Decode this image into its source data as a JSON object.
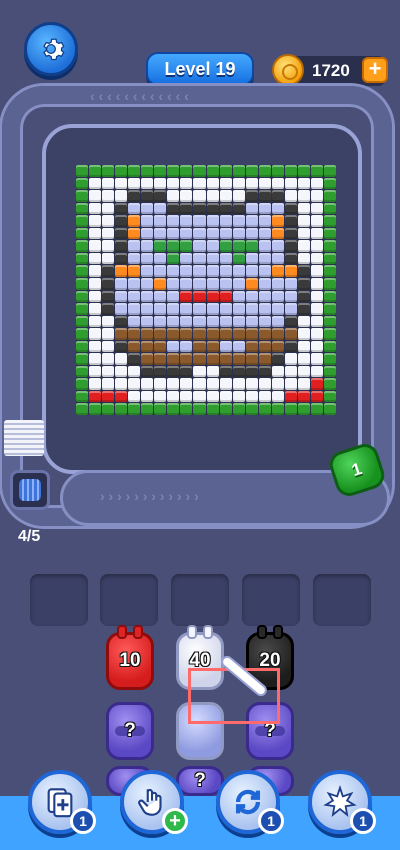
{
  "header": {
    "level_label": "Level 19",
    "coins": "1720",
    "coin_plus": "+"
  },
  "queue": {
    "progress": "4/5"
  },
  "moving_shooter": {
    "color": "#2fb13a",
    "count": "1"
  },
  "puzzle": {
    "rows": 20,
    "cols": 20,
    "palette": {
      "G": "#2f9e2f",
      "W": "#f4f6fb",
      "L": "#bac2f2",
      "K": "#3a3a3a",
      "O": "#ff8a1f",
      "R": "#e02020",
      "B": "#8a5a2c",
      "E": "#32a040"
    },
    "grid": [
      "GGGGGGGGGGGGGGGGGGGG",
      "GWWWWWWWWWWWWWWWWWWG",
      "GWWWKKKWWWWWWKKKWWWG",
      "GWWKLLLKKKKKKLLLKWWG",
      "GWWKOLLLLLLLLLLOKWWG",
      "GWWKOLLLLLLLLLLOKWWG",
      "GWWKLLEEELLEEELLKWWG",
      "GWWKLLLELLLLELLLKWWG",
      "GWKOOLLLLLLLLLLOOKWG",
      "GWKLLLOLLLLLLOLLLKWG",
      "GWKLLLLLRRRRLLLLLKWG",
      "GWKLLLLLLLLLLLLLLKWG",
      "GWWKLLLLLLLLLLLLKWWG",
      "GWWBBBBBBBBBBBBBBWWG",
      "GWWKBBBLLBBLLBBBKWWG",
      "GWWWKBBBBBBBBBBKWWWG",
      "GWWWWKKKKWWKKKKWWWWG",
      "GWWWWWWWWWWWWWWWWWRG",
      "GRRRWWWWWWWWWWWWRRRG",
      "GGGGGGGGGGGGGGGGGGGG"
    ]
  },
  "slots": 5,
  "shooters": {
    "front": [
      {
        "color": "red",
        "count": "10"
      },
      {
        "color": "white",
        "count": "40"
      },
      {
        "color": "black",
        "count": "20"
      }
    ],
    "hidden_label": "?"
  },
  "boosters": [
    {
      "icon": "add-card-icon",
      "count": "1"
    },
    {
      "icon": "hand-icon",
      "count": "+"
    },
    {
      "icon": "refresh-icon",
      "count": "1"
    },
    {
      "icon": "burst-icon",
      "count": "1"
    }
  ]
}
